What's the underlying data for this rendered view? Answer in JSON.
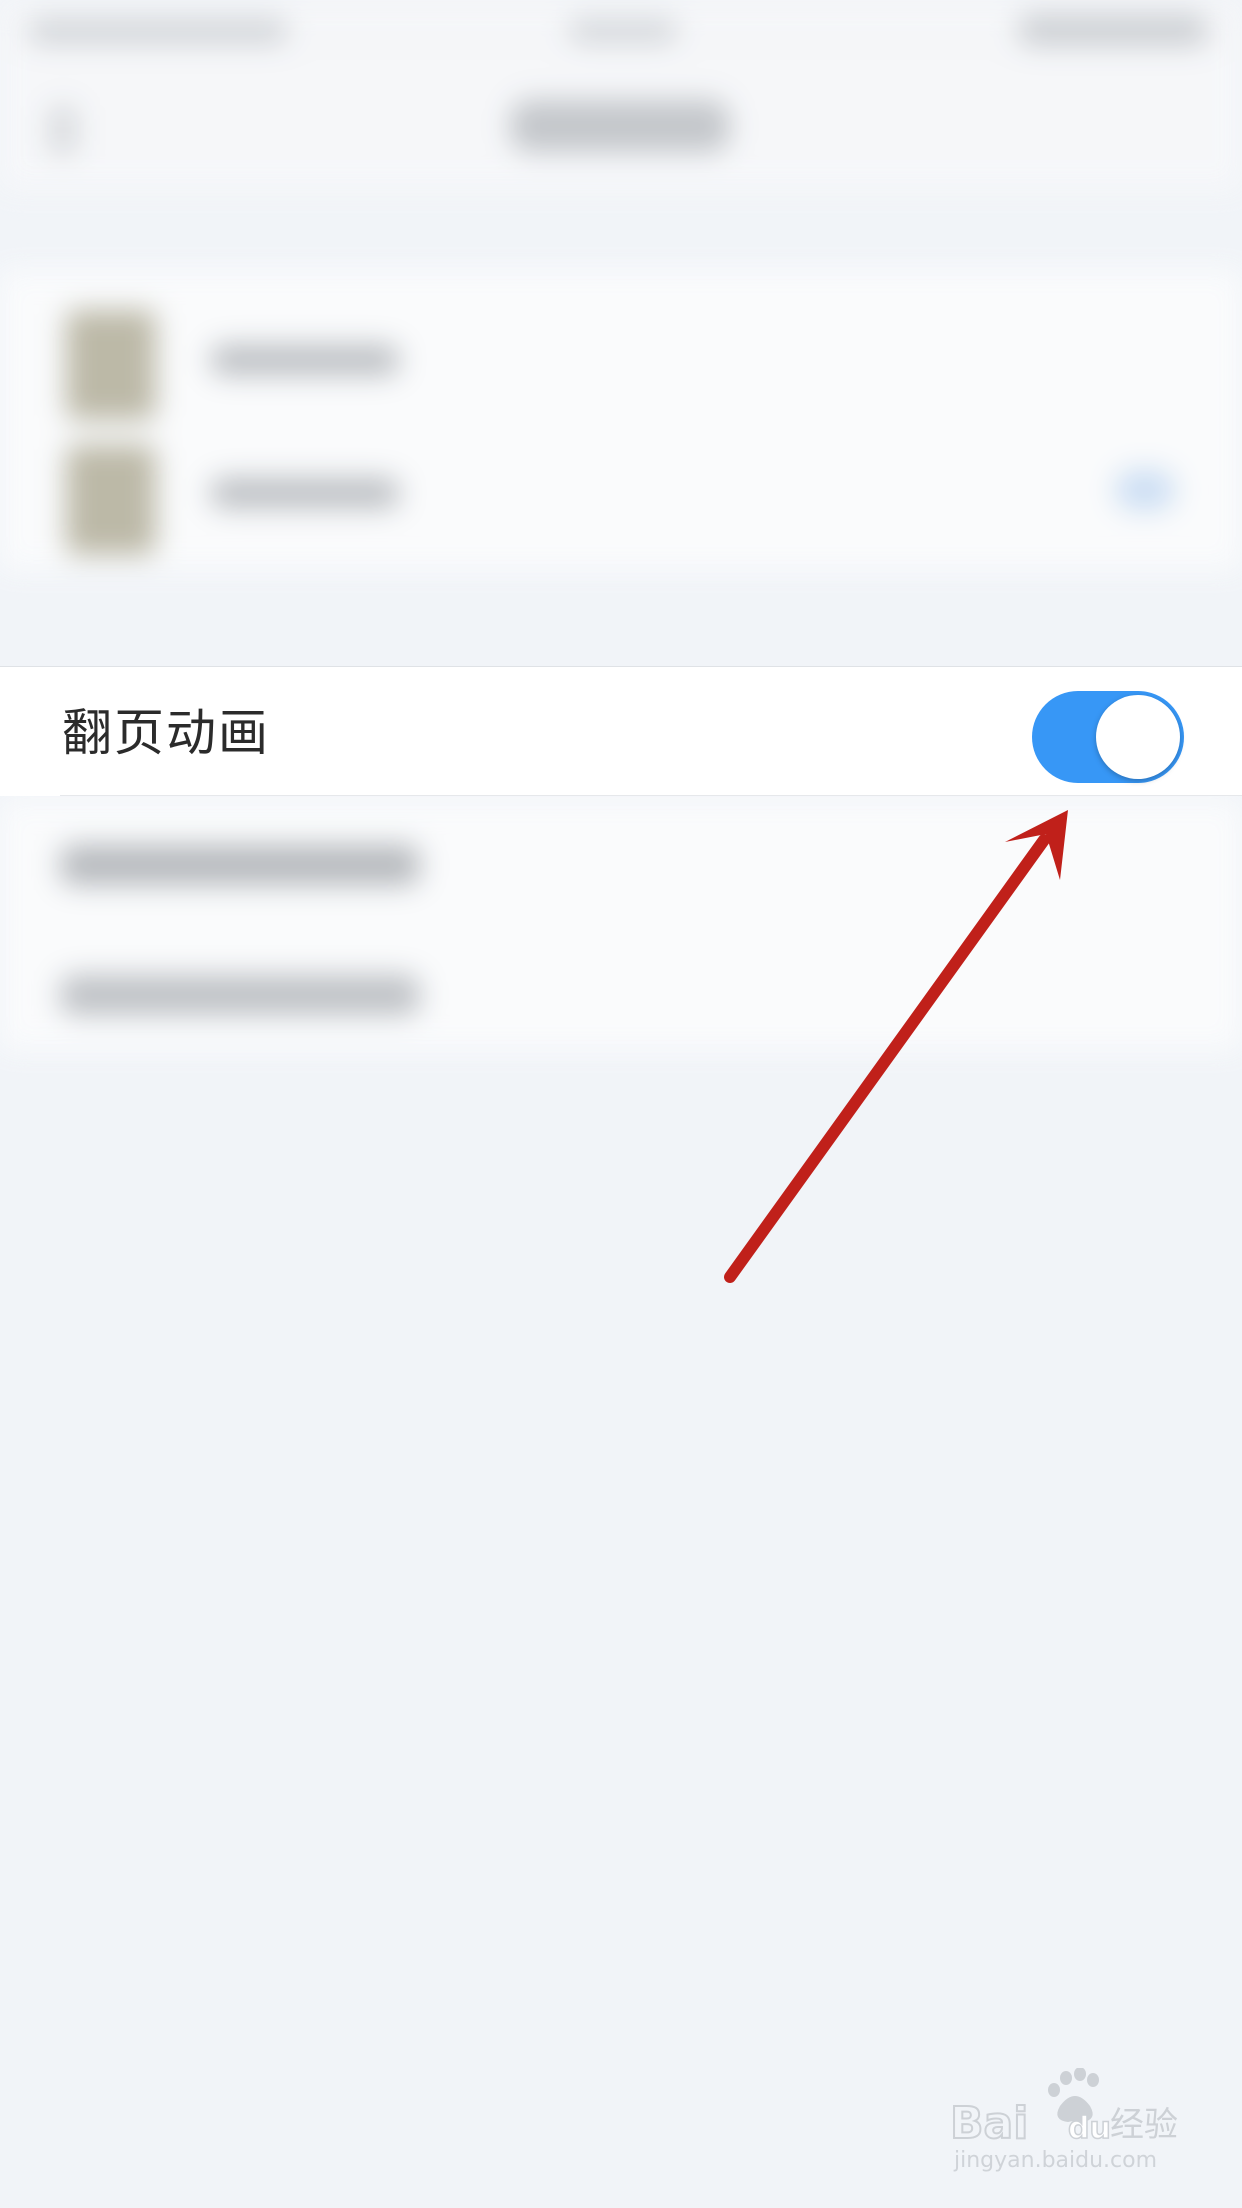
{
  "setting": {
    "label": "翻页动画",
    "toggle_state": "on",
    "toggle_color": "#3797f6"
  },
  "annotation": {
    "arrow_color": "#c0201a"
  },
  "watermark": {
    "brand_mark": "Baidu经验",
    "url": "jingyan.baidu.com"
  }
}
